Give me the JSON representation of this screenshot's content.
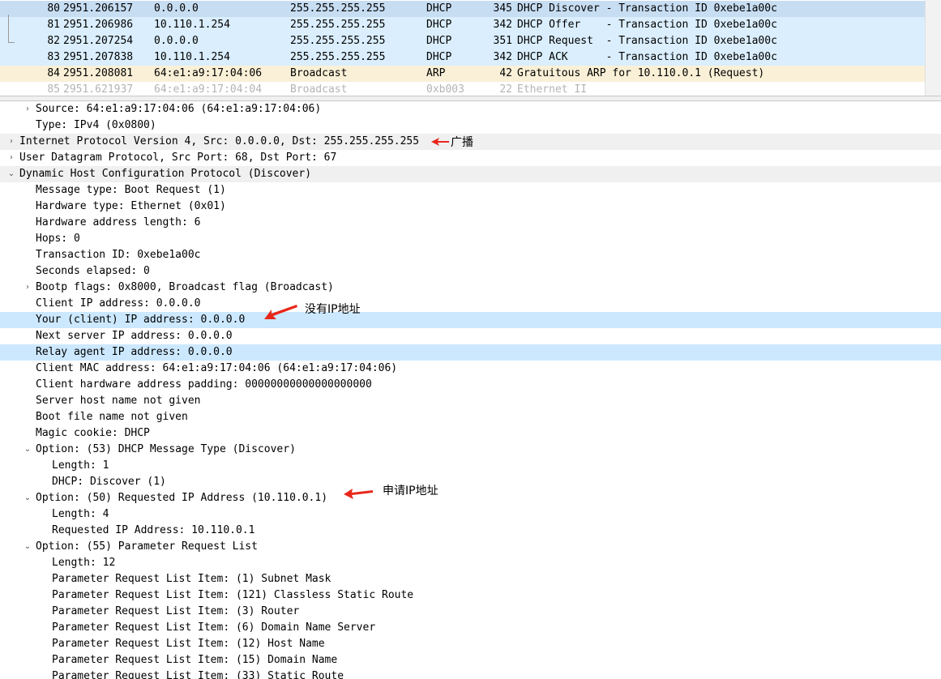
{
  "colors": {
    "selected_row": "#c7ddf2",
    "dhcp_row": "#daeefd",
    "arp_row": "#faf0d7",
    "section_header_bg": "#f0f0f0",
    "highlight_field": "#cce8ff",
    "annotation_red": "#e8271a"
  },
  "packet_list": {
    "rows": [
      {
        "no": "80",
        "time": "2951.206157",
        "src": "0.0.0.0",
        "dst": "255.255.255.255",
        "proto": "DHCP",
        "len": "345",
        "info": "DHCP Discover - Transaction ID 0xebe1a00c",
        "state": "selected"
      },
      {
        "no": "81",
        "time": "2951.206986",
        "src": "10.110.1.254",
        "dst": "255.255.255.255",
        "proto": "DHCP",
        "len": "342",
        "info": "DHCP Offer    - Transaction ID 0xebe1a00c",
        "state": "dhcp"
      },
      {
        "no": "82",
        "time": "2951.207254",
        "src": "0.0.0.0",
        "dst": "255.255.255.255",
        "proto": "DHCP",
        "len": "351",
        "info": "DHCP Request  - Transaction ID 0xebe1a00c",
        "state": "dhcp"
      },
      {
        "no": "83",
        "time": "2951.207838",
        "src": "10.110.1.254",
        "dst": "255.255.255.255",
        "proto": "DHCP",
        "len": "342",
        "info": "DHCP ACK      - Transaction ID 0xebe1a00c",
        "state": "dhcp"
      },
      {
        "no": "84",
        "time": "2951.208081",
        "src": "64:e1:a9:17:04:06",
        "dst": "Broadcast",
        "proto": "ARP",
        "len": "42",
        "info": "Gratuitous ARP for 10.110.0.1 (Request)",
        "state": "arp"
      },
      {
        "no": "85",
        "time": "2951.621937",
        "src": "64:e1:a9:17:04:04",
        "dst": "Broadcast",
        "proto": "0xb003",
        "len": "22",
        "info": "Ethernet II",
        "state": "faded"
      }
    ]
  },
  "detail_tree": {
    "rows": [
      {
        "indent": 1,
        "arrow": "›",
        "text": "Source: 64:e1:a9:17:04:06 (64:e1:a9:17:04:06)"
      },
      {
        "indent": 1,
        "arrow": "",
        "text": "Type: IPv4 (0x0800)"
      },
      {
        "indent": 0,
        "arrow": "›",
        "text": "Internet Protocol Version 4, Src: 0.0.0.0, Dst: 255.255.255.255",
        "bg": "section"
      },
      {
        "indent": 0,
        "arrow": "›",
        "text": "User Datagram Protocol, Src Port: 68, Dst Port: 67"
      },
      {
        "indent": 0,
        "arrow": "⌄",
        "text": "Dynamic Host Configuration Protocol (Discover)",
        "bg": "section"
      },
      {
        "indent": 1,
        "arrow": "",
        "text": "Message type: Boot Request (1)"
      },
      {
        "indent": 1,
        "arrow": "",
        "text": "Hardware type: Ethernet (0x01)"
      },
      {
        "indent": 1,
        "arrow": "",
        "text": "Hardware address length: 6"
      },
      {
        "indent": 1,
        "arrow": "",
        "text": "Hops: 0"
      },
      {
        "indent": 1,
        "arrow": "",
        "text": "Transaction ID: 0xebe1a00c"
      },
      {
        "indent": 1,
        "arrow": "",
        "text": "Seconds elapsed: 0"
      },
      {
        "indent": 1,
        "arrow": "›",
        "text": "Bootp flags: 0x8000, Broadcast flag (Broadcast)"
      },
      {
        "indent": 1,
        "arrow": "",
        "text": "Client IP address: 0.0.0.0"
      },
      {
        "indent": 1,
        "arrow": "",
        "text": "Your (client) IP address: 0.0.0.0",
        "bg": "highlight"
      },
      {
        "indent": 1,
        "arrow": "",
        "text": "Next server IP address: 0.0.0.0"
      },
      {
        "indent": 1,
        "arrow": "",
        "text": "Relay agent IP address: 0.0.0.0",
        "bg": "highlight"
      },
      {
        "indent": 1,
        "arrow": "",
        "text": "Client MAC address: 64:e1:a9:17:04:06 (64:e1:a9:17:04:06)"
      },
      {
        "indent": 1,
        "arrow": "",
        "text": "Client hardware address padding: 00000000000000000000"
      },
      {
        "indent": 1,
        "arrow": "",
        "text": "Server host name not given"
      },
      {
        "indent": 1,
        "arrow": "",
        "text": "Boot file name not given"
      },
      {
        "indent": 1,
        "arrow": "",
        "text": "Magic cookie: DHCP"
      },
      {
        "indent": 1,
        "arrow": "⌄",
        "text": "Option: (53) DHCP Message Type (Discover)"
      },
      {
        "indent": 2,
        "arrow": "",
        "text": "Length: 1"
      },
      {
        "indent": 2,
        "arrow": "",
        "text": "DHCP: Discover (1)"
      },
      {
        "indent": 1,
        "arrow": "⌄",
        "text": "Option: (50) Requested IP Address (10.110.0.1)"
      },
      {
        "indent": 2,
        "arrow": "",
        "text": "Length: 4"
      },
      {
        "indent": 2,
        "arrow": "",
        "text": "Requested IP Address: 10.110.0.1"
      },
      {
        "indent": 1,
        "arrow": "⌄",
        "text": "Option: (55) Parameter Request List"
      },
      {
        "indent": 2,
        "arrow": "",
        "text": "Length: 12"
      },
      {
        "indent": 2,
        "arrow": "",
        "text": "Parameter Request List Item: (1) Subnet Mask"
      },
      {
        "indent": 2,
        "arrow": "",
        "text": "Parameter Request List Item: (121) Classless Static Route"
      },
      {
        "indent": 2,
        "arrow": "",
        "text": "Parameter Request List Item: (3) Router"
      },
      {
        "indent": 2,
        "arrow": "",
        "text": "Parameter Request List Item: (6) Domain Name Server"
      },
      {
        "indent": 2,
        "arrow": "",
        "text": "Parameter Request List Item: (12) Host Name"
      },
      {
        "indent": 2,
        "arrow": "",
        "text": "Parameter Request List Item: (15) Domain Name"
      },
      {
        "indent": 2,
        "arrow": "",
        "text": "Parameter Request List Item: (33) Static Route"
      }
    ]
  },
  "annotations": {
    "broadcast": "广播",
    "no_ip": "没有IP地址",
    "request_ip": "申请IP地址"
  }
}
